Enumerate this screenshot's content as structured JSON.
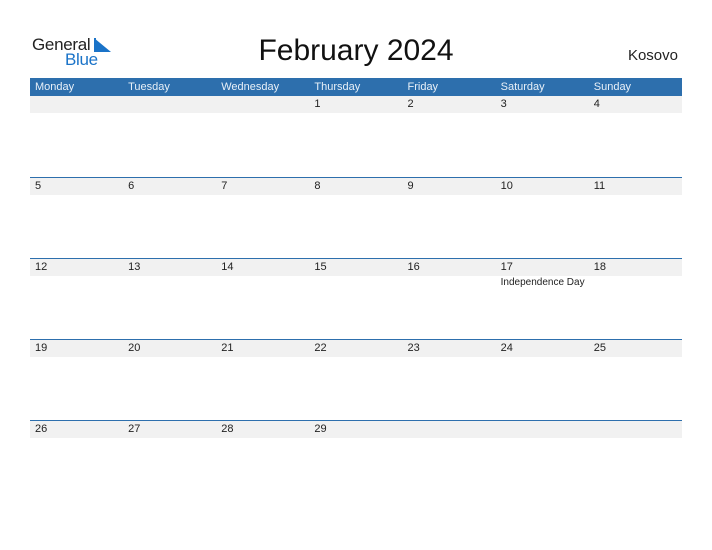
{
  "logo": {
    "word1": "General",
    "word2": "Blue",
    "icon": "triangle-flag-icon"
  },
  "header": {
    "title": "February 2024",
    "country": "Kosovo"
  },
  "colors": {
    "accent": "#2d6fad",
    "band": "#f1f1f1",
    "logo_blue": "#1a73c8"
  },
  "days": [
    "Monday",
    "Tuesday",
    "Wednesday",
    "Thursday",
    "Friday",
    "Saturday",
    "Sunday"
  ],
  "weeks": [
    {
      "dates": [
        "",
        "",
        "",
        "1",
        "2",
        "3",
        "4"
      ],
      "holidays": [
        "",
        "",
        "",
        "",
        "",
        "",
        ""
      ]
    },
    {
      "dates": [
        "5",
        "6",
        "7",
        "8",
        "9",
        "10",
        "11"
      ],
      "holidays": [
        "",
        "",
        "",
        "",
        "",
        "",
        ""
      ]
    },
    {
      "dates": [
        "12",
        "13",
        "14",
        "15",
        "16",
        "17",
        "18"
      ],
      "holidays": [
        "",
        "",
        "",
        "",
        "",
        "Independence Day",
        ""
      ]
    },
    {
      "dates": [
        "19",
        "20",
        "21",
        "22",
        "23",
        "24",
        "25"
      ],
      "holidays": [
        "",
        "",
        "",
        "",
        "",
        "",
        ""
      ]
    },
    {
      "dates": [
        "26",
        "27",
        "28",
        "29",
        "",
        "",
        ""
      ],
      "holidays": [
        "",
        "",
        "",
        "",
        "",
        "",
        ""
      ]
    }
  ]
}
